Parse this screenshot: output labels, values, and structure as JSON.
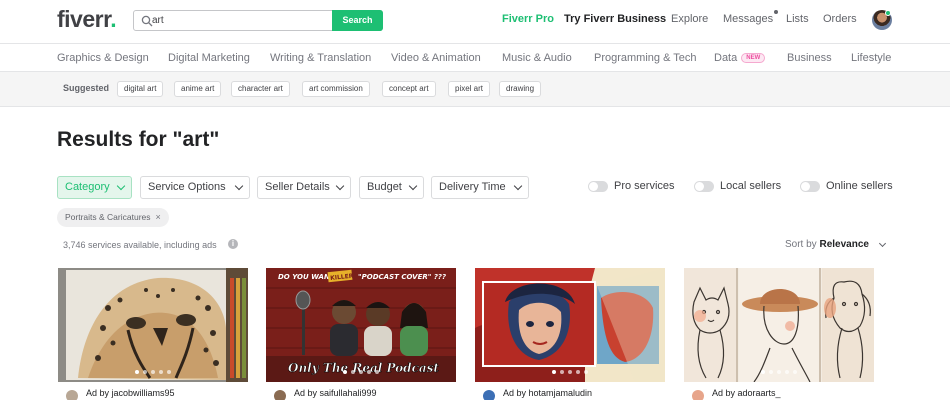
{
  "brand": {
    "logo_text": "fiverr",
    "logo_dot": ".",
    "accent": "#1dbf73"
  },
  "search": {
    "value": "art",
    "button_label": "Search"
  },
  "nav": {
    "fiverr_pro": "Fiverr Pro",
    "try_business": "Try Fiverr Business",
    "explore": "Explore",
    "messages": "Messages",
    "lists": "Lists",
    "orders": "Orders"
  },
  "categories": [
    "Graphics & Design",
    "Digital Marketing",
    "Writing & Translation",
    "Video & Animation",
    "Music & Audio",
    "Programming & Tech",
    "Data",
    "Business",
    "Lifestyle"
  ],
  "data_badge": "NEW",
  "suggested": {
    "label": "Suggested",
    "tags": [
      "digital art",
      "anime art",
      "character art",
      "art commission",
      "concept art",
      "pixel art",
      "drawing"
    ]
  },
  "results_title": "Results for \"art\"",
  "filters": [
    "Category",
    "Service Options",
    "Seller Details",
    "Budget",
    "Delivery Time"
  ],
  "toggles": [
    "Pro services",
    "Local sellers",
    "Online sellers"
  ],
  "active_chip": {
    "label": "Portraits & Caricatures",
    "remove": "×"
  },
  "count_text": "3,746 services available, including ads",
  "info_glyph": "i",
  "sort": {
    "label": "Sort by",
    "value": "Relevance"
  },
  "gigs": [
    {
      "seller_text": "Ad by jacobwilliams95",
      "image": "cheetah-pencil-drawing"
    },
    {
      "seller_text": "Ad by saifullahali999",
      "image": "podcast-cover-cartoon",
      "caption_top": "DO YOU WANT A",
      "caption_mid": "KILLER",
      "caption_quote": "\"PODCAST COVER\" ???",
      "caption_bottom": "Only The Real Podcast"
    },
    {
      "seller_text": "Ad by hotamjamaludin",
      "image": "pop-art-portrait"
    },
    {
      "seller_text": "Ad by adoraarts_",
      "image": "line-art-animals"
    }
  ]
}
